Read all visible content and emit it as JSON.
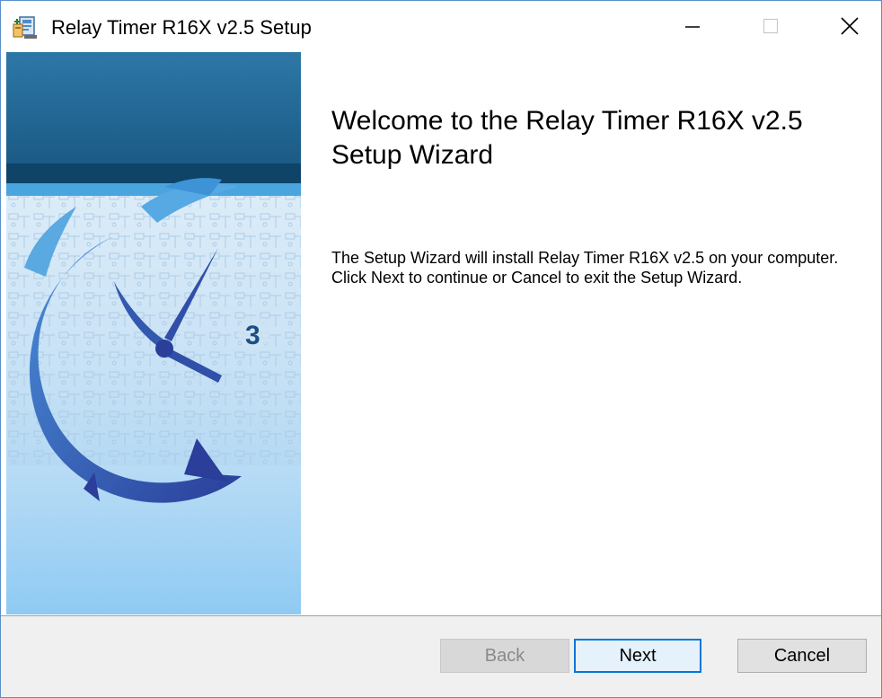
{
  "window": {
    "title": "Relay Timer R16X v2.5 Setup",
    "controls": {
      "minimize_icon": "minimize-icon",
      "maximize_icon": "maximize-icon",
      "close_icon": "close-icon"
    }
  },
  "wizard": {
    "heading": "Welcome to the Relay Timer R16X v2.5 Setup Wizard",
    "description": "The Setup Wizard will install Relay Timer R16X v2.5 on your computer. Click Next to continue or Cancel to exit the Setup Wizard.",
    "banner_badge": "3"
  },
  "buttons": {
    "back": "Back",
    "next": "Next",
    "cancel": "Cancel"
  },
  "state": {
    "back_enabled": false,
    "default_button": "next"
  },
  "colors": {
    "accent": "#0078d7",
    "banner_dark": "#1e5f8a",
    "banner_light": "#9fd4f7"
  }
}
